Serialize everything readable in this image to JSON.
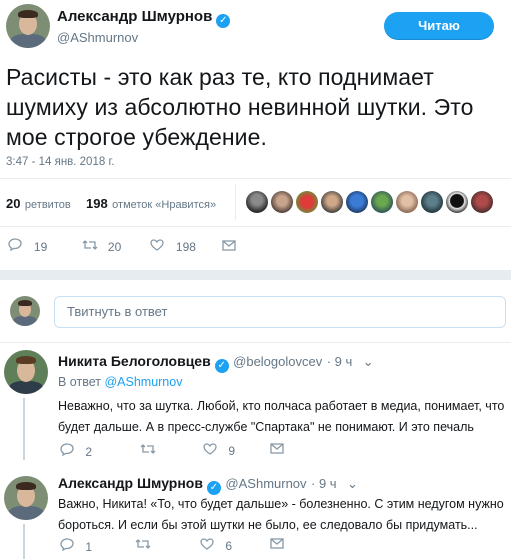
{
  "main_tweet": {
    "author_name": "Александр Шмурнов",
    "author_handle": "@AShmurnov",
    "follow_label": "Читаю",
    "text_lines": [
      "Расисты - это как раз те, кто поднимает",
      "шумиху из абсолютно невинной шутки. Это",
      "мое строгое убеждение."
    ],
    "timestamp": "3:47 - 14 янв. 2018 г.",
    "retweets_count": "20",
    "retweets_label": "ретвитов",
    "likes_count": "198",
    "likes_label": "отметок «Нравится»",
    "actions": {
      "reply_count": "19",
      "retweet_count": "20",
      "like_count": "198"
    }
  },
  "reply_composer": {
    "placeholder": "Твитнуть в ответ"
  },
  "replies": [
    {
      "author_name": "Никита Белоголовцев",
      "author_handle": "@belogolovcev",
      "time": "· 9 ч",
      "in_reply_prefix": "В ответ",
      "in_reply_handle": "@AShmurnov",
      "text_lines": [
        "Неважно, что за шутка. Любой, кто полчаса работает в медиа, понимает, что",
        "будет дальше. А в пресс-службе \"Спартака\" не понимают. И это печаль"
      ],
      "reply_count": "2",
      "retweet_count": "",
      "like_count": "9"
    },
    {
      "author_name": "Александр Шмурнов",
      "author_handle": "@AShmurnov",
      "time": "· 9 ч",
      "text_lines": [
        "Важно, Никита! «То, что будет дальше» - болезненно. С этим недугом нужно",
        "бороться. И если бы этой шутки не было, ее следовало бы придумать..."
      ],
      "reply_count": "1",
      "retweet_count": "",
      "like_count": "6"
    }
  ],
  "icons": {
    "reply": "reply-icon",
    "retweet": "retweet-icon",
    "like": "heart-icon",
    "dm": "envelope-icon",
    "verified": "verified-badge-icon"
  },
  "colors": {
    "accent": "#1da1f2",
    "muted": "#657786",
    "border": "#e6ecf0"
  }
}
